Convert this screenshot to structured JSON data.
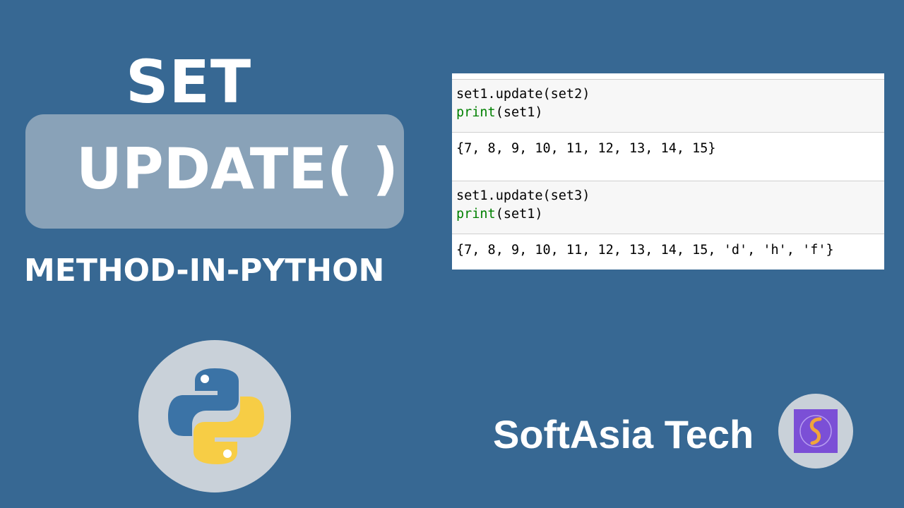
{
  "heading": {
    "line1": "SET",
    "line2": "UPDATE( )",
    "line3": "METHOD-IN-PYTHON"
  },
  "notebook": {
    "cells": [
      {
        "input": [
          {
            "code": "set1.update(set2)"
          },
          {
            "keyword": "print",
            "rest": "(set1)"
          }
        ],
        "output": "{7, 8, 9, 10, 11, 12, 13, 14, 15}"
      },
      {
        "input": [
          {
            "code": "set1.update(set3)"
          },
          {
            "keyword": "print",
            "rest": "(set1)"
          }
        ],
        "output": "{7, 8, 9, 10, 11, 12, 13, 14, 15, 'd', 'h', 'f'}"
      }
    ]
  },
  "brand": {
    "name": "SoftAsia Tech"
  },
  "icons": {
    "python_logo": "python-logo-icon",
    "brand_logo": "softasia-logo-icon"
  },
  "colors": {
    "background": "#376893",
    "title_box": "#89a2b8",
    "keyword_green": "#008000",
    "python_blue": "#3b73a6",
    "python_yellow": "#f7cd45",
    "brand_purple": "#7b4fd6",
    "brand_gold": "#f0a53b"
  }
}
